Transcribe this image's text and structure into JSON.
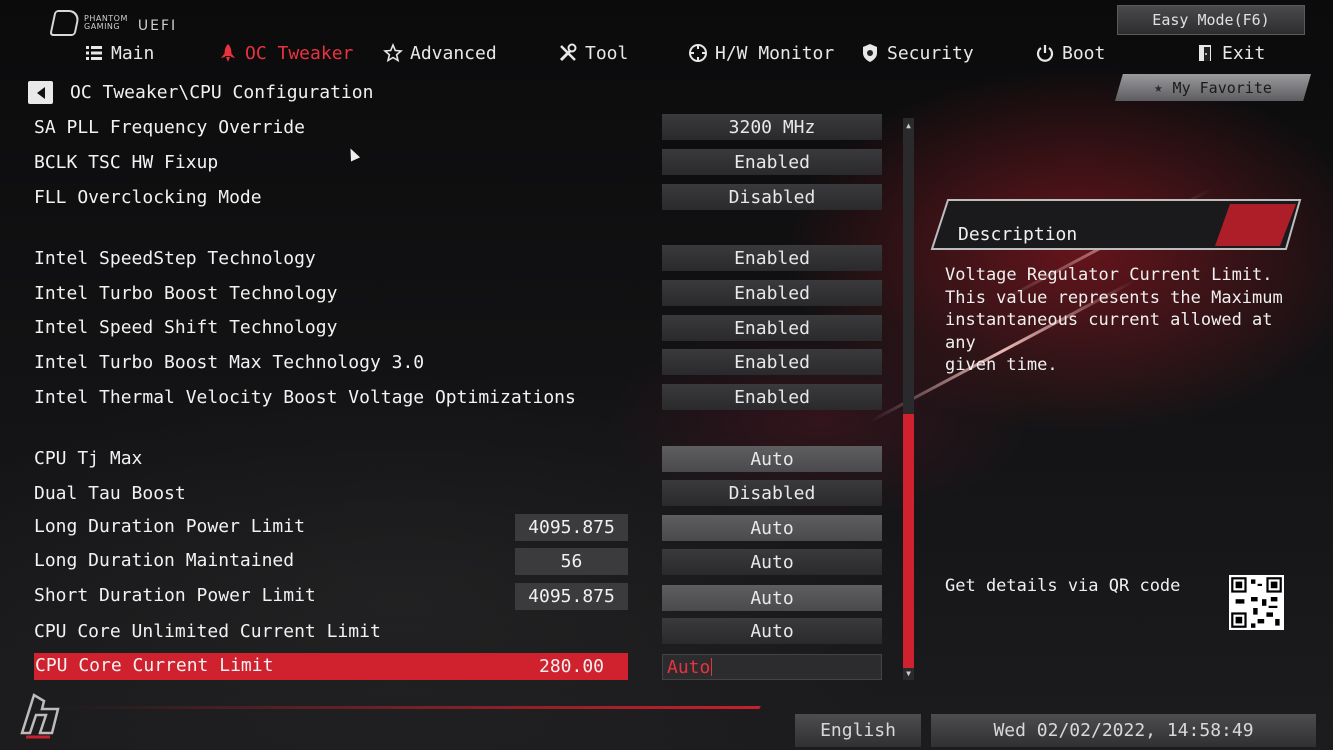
{
  "brand": {
    "line1": "PHANTOM",
    "line2": "GAMING",
    "uefi": "UEFI"
  },
  "easy_mode_label": "Easy Mode(F6)",
  "nav": [
    {
      "label": "Main",
      "icon": "list-icon",
      "active": false
    },
    {
      "label": "OC Tweaker",
      "icon": "rocket-icon",
      "active": true
    },
    {
      "label": "Advanced",
      "icon": "star-icon",
      "active": false
    },
    {
      "label": "Tool",
      "icon": "wrench-icon",
      "active": false
    },
    {
      "label": "H/W Monitor",
      "icon": "monitor-icon",
      "active": false
    },
    {
      "label": "Security",
      "icon": "shield-icon",
      "active": false
    },
    {
      "label": "Boot",
      "icon": "power-icon",
      "active": false
    },
    {
      "label": "Exit",
      "icon": "exit-icon",
      "active": false
    }
  ],
  "breadcrumb": "OC Tweaker\\CPU Configuration",
  "favorite_label": "My Favorite",
  "settings": [
    {
      "label": "SA PLL Frequency Override",
      "value": "3200 MHz"
    },
    {
      "label": "BCLK TSC HW Fixup",
      "value": "Enabled"
    },
    {
      "label": "FLL Overclocking Mode",
      "value": "Disabled"
    },
    {
      "label": "Intel SpeedStep Technology",
      "value": "Enabled"
    },
    {
      "label": "Intel Turbo Boost Technology",
      "value": "Enabled"
    },
    {
      "label": "Intel Speed Shift Technology",
      "value": "Enabled"
    },
    {
      "label": "Intel Turbo Boost Max Technology 3.0",
      "value": "Enabled"
    },
    {
      "label": "Intel Thermal Velocity Boost Voltage Optimizations",
      "value": "Enabled"
    },
    {
      "label": "CPU Tj Max",
      "value": "Auto"
    },
    {
      "label": "Dual Tau Boost",
      "value": "Disabled"
    },
    {
      "label": "Long Duration Power Limit",
      "current": "4095.875",
      "value": "Auto"
    },
    {
      "label": "Long Duration Maintained",
      "current": "56",
      "value": "Auto"
    },
    {
      "label": "Short Duration Power Limit",
      "current": "4095.875",
      "value": "Auto"
    },
    {
      "label": "CPU Core Unlimited Current Limit",
      "value": "Auto"
    },
    {
      "label": "CPU Core Current Limit",
      "current": "280.00",
      "value": "Auto",
      "selected": true
    }
  ],
  "description": {
    "title": "Description",
    "text": "Voltage Regulator Current Limit.\nThis value represents the Maximum\ninstantaneous current allowed at any\ngiven time.",
    "qr_label": "Get details via QR code"
  },
  "footer": {
    "language": "English",
    "datetime": "Wed 02/02/2022, 14:58:49"
  },
  "colors": {
    "accent": "#d0222e",
    "active_tab": "#e8333f",
    "background": "#0b0b0c"
  }
}
